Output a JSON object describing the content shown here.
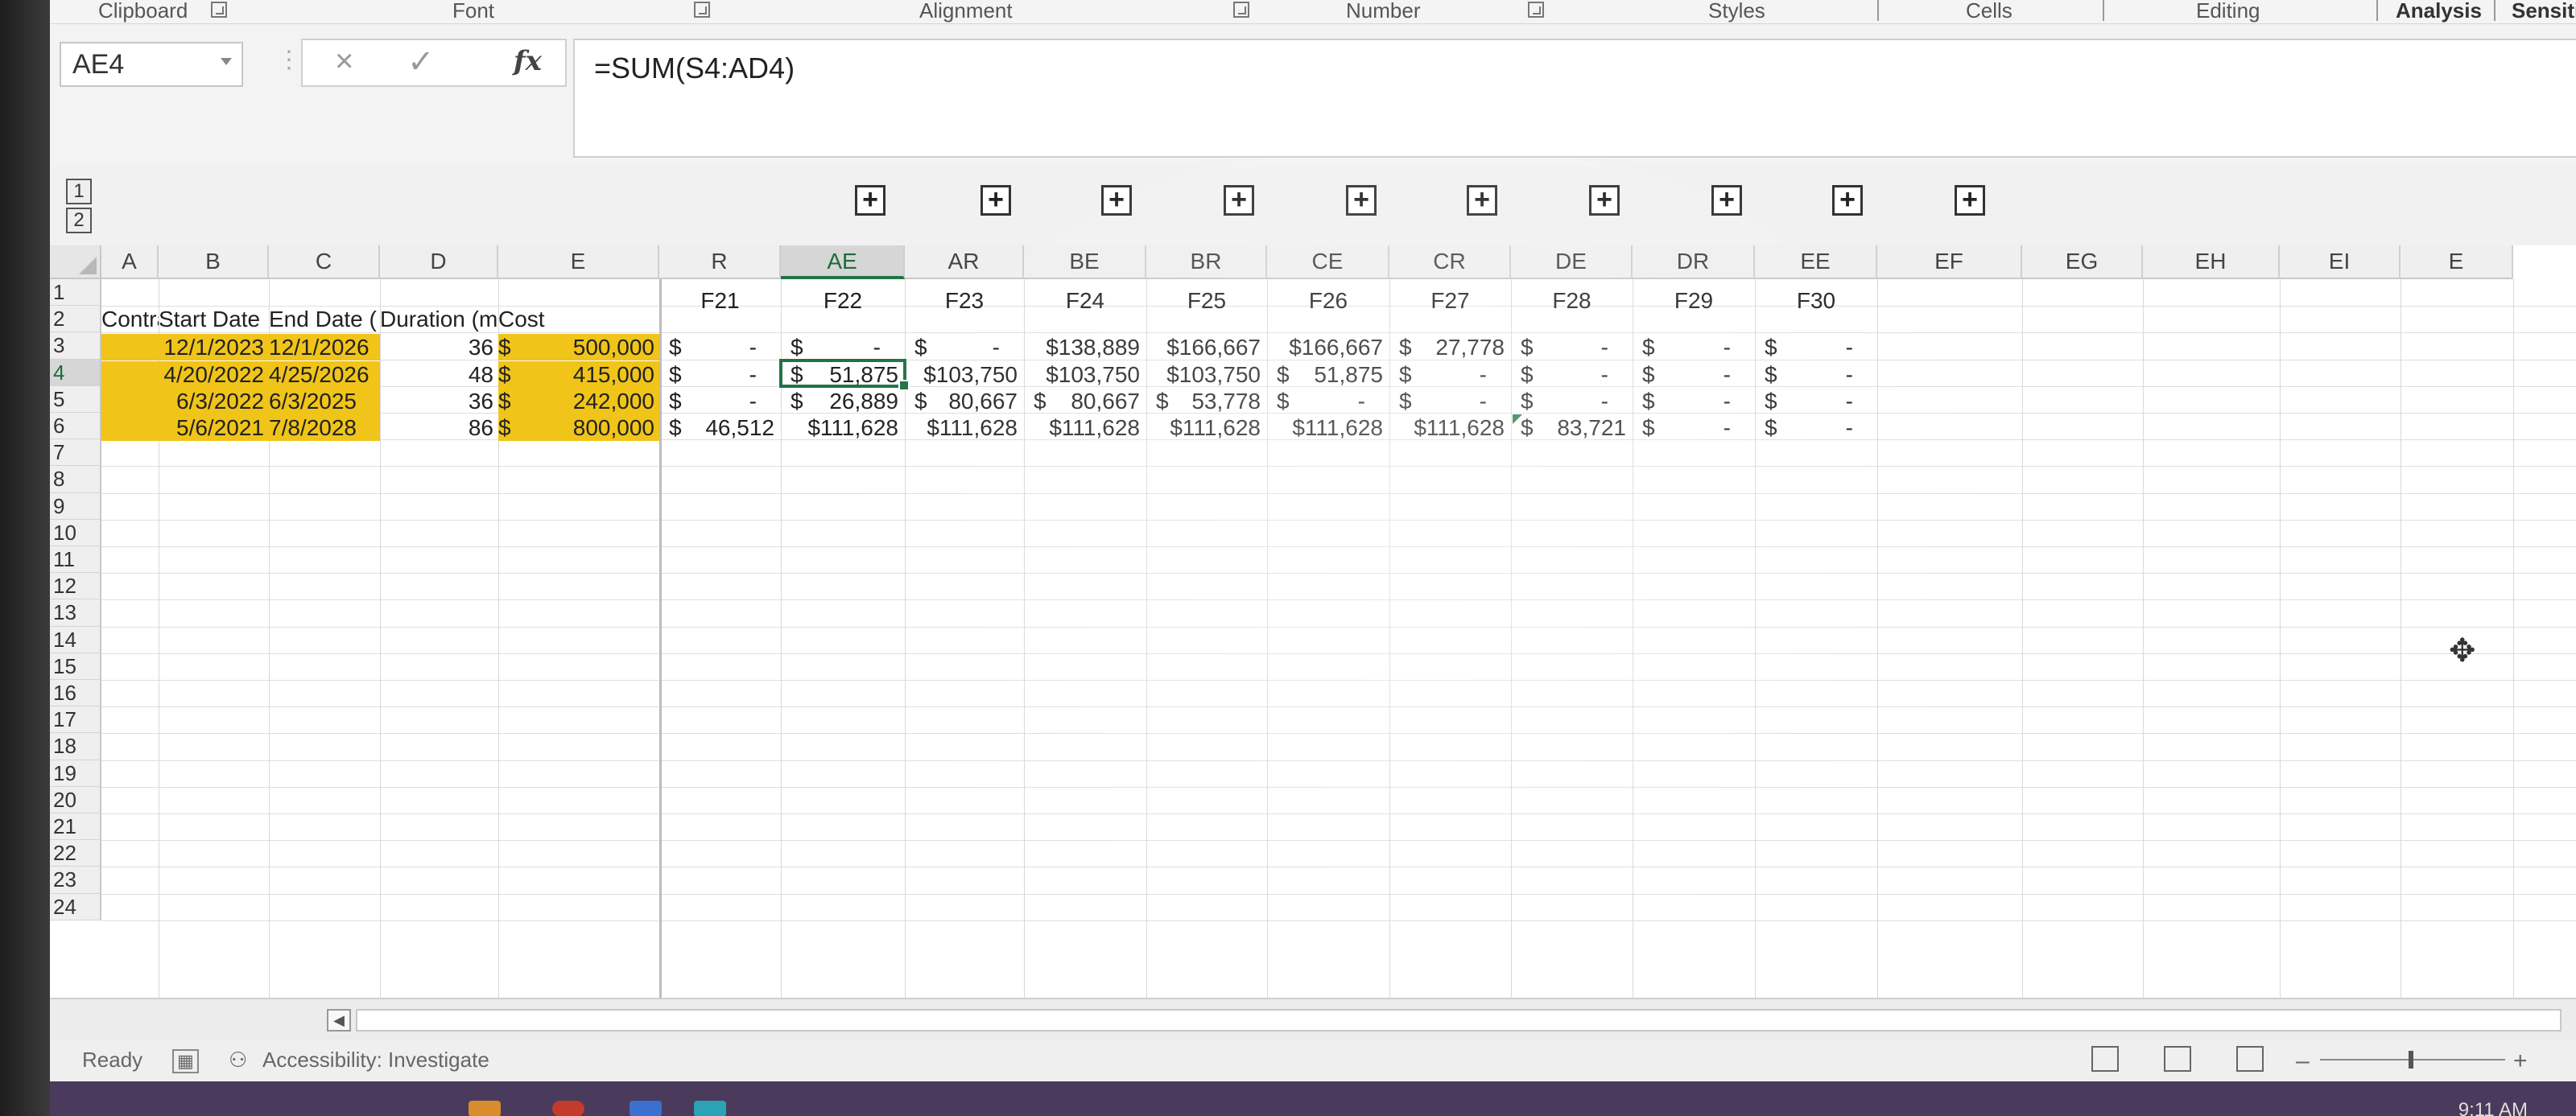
{
  "ribbon": {
    "groups": [
      "Clipboard",
      "Font",
      "Alignment",
      "Number",
      "Styles",
      "Cells",
      "Editing",
      "Analysis",
      "Sensitivity"
    ]
  },
  "formula_bar": {
    "name_box": "AE4",
    "cancel_glyph": "×",
    "enter_glyph": "✓",
    "fx_label": "fx",
    "formula": "=SUM(S4:AD4)"
  },
  "outline": {
    "levels": [
      "1",
      "2"
    ],
    "expand_glyph": "+"
  },
  "columns": [
    "A",
    "B",
    "C",
    "D",
    "E",
    "R",
    "AE",
    "AR",
    "BE",
    "BR",
    "CE",
    "CR",
    "DE",
    "DR",
    "EE",
    "EF",
    "EG",
    "EH",
    "EI",
    "E"
  ],
  "rows": [
    "1",
    "2",
    "3",
    "4",
    "5",
    "6",
    "7",
    "8",
    "9",
    "10",
    "11",
    "12",
    "13",
    "14",
    "15",
    "16",
    "17",
    "18",
    "19",
    "20",
    "21",
    "22",
    "23",
    "24"
  ],
  "headers": {
    "contract": "Contract N",
    "start": "Start Date",
    "end": "End Date (",
    "duration": "Duration (mnth",
    "cost": "Cost",
    "fiscal": [
      "F21",
      "F22",
      "F23",
      "F24",
      "F25",
      "F26",
      "F27",
      "F28",
      "F29",
      "F30"
    ]
  },
  "data_rows": [
    {
      "start": "12/1/2023",
      "end": "12/1/2026",
      "duration": "36",
      "cost_sym": "$",
      "cost": "500,000",
      "fy": [
        [
          "$",
          "-"
        ],
        [
          "$",
          "-"
        ],
        [
          "$",
          "-"
        ],
        [
          "",
          "$138,889"
        ],
        [
          "",
          "$166,667"
        ],
        [
          "",
          "$166,667"
        ],
        [
          "$",
          "27,778"
        ],
        [
          "$",
          "-"
        ],
        [
          "$",
          "-"
        ],
        [
          "$",
          "-"
        ]
      ]
    },
    {
      "start": "4/20/2022",
      "end": "4/25/2026",
      "duration": "48",
      "cost_sym": "$",
      "cost": "415,000",
      "fy": [
        [
          "$",
          "-"
        ],
        [
          "$",
          "51,875"
        ],
        [
          "",
          "$103,750"
        ],
        [
          "",
          "$103,750"
        ],
        [
          "",
          "$103,750"
        ],
        [
          "$",
          "51,875"
        ],
        [
          "$",
          "-"
        ],
        [
          "$",
          "-"
        ],
        [
          "$",
          "-"
        ],
        [
          "$",
          "-"
        ]
      ]
    },
    {
      "start": "6/3/2022",
      "end": "6/3/2025",
      "duration": "36",
      "cost_sym": "$",
      "cost": "242,000",
      "fy": [
        [
          "$",
          "-"
        ],
        [
          "$",
          "26,889"
        ],
        [
          "$",
          "80,667"
        ],
        [
          "$",
          "80,667"
        ],
        [
          "$",
          "53,778"
        ],
        [
          "$",
          "-"
        ],
        [
          "$",
          "-"
        ],
        [
          "$",
          "-"
        ],
        [
          "$",
          "-"
        ],
        [
          "$",
          "-"
        ]
      ]
    },
    {
      "start": "5/6/2021",
      "end": "7/8/2028",
      "duration": "86",
      "cost_sym": "$",
      "cost": "800,000",
      "fy": [
        [
          "$",
          "46,512"
        ],
        [
          "",
          "$111,628"
        ],
        [
          "",
          "$111,628"
        ],
        [
          "",
          "$111,628"
        ],
        [
          "",
          "$111,628"
        ],
        [
          "",
          "$111,628"
        ],
        [
          "",
          "$111,628"
        ],
        [
          "$",
          "83,721"
        ],
        [
          "$",
          "-"
        ],
        [
          "$",
          "-"
        ]
      ]
    }
  ],
  "status": {
    "ready": "Ready",
    "accessibility": "Accessibility: Investigate",
    "clock": "9:11 AM"
  },
  "colors": {
    "highlight": "#f0c419",
    "active_border": "#217346"
  }
}
